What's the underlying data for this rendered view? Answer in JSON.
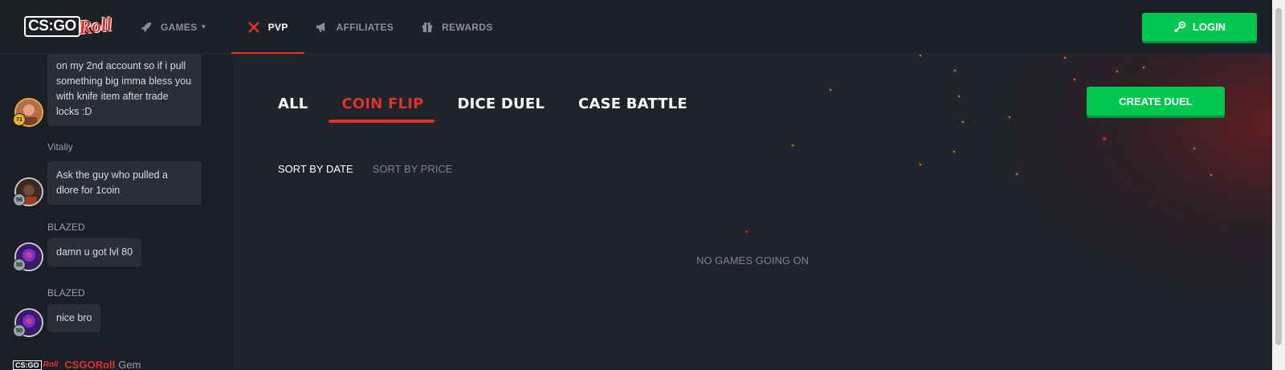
{
  "header": {
    "logo": {
      "text_main": "CS:GO",
      "text_roll": "Roll"
    },
    "nav": [
      {
        "label": "GAMES",
        "icon": "rocket-icon",
        "has_caret": true
      },
      {
        "label": "PVP",
        "icon": "crossed-swords-icon",
        "active": true
      },
      {
        "label": "AFFILIATES",
        "icon": "megaphone-icon"
      },
      {
        "label": "REWARDS",
        "icon": "gift-icon"
      }
    ],
    "login_label": "LOGIN",
    "login_icon": "steam-icon"
  },
  "chat": {
    "messages": [
      {
        "username": "",
        "level": "71",
        "level_color": "gold",
        "text": "on my 2nd account so if i pull something big imma bless you with knife item after trade locks :D"
      },
      {
        "username": "Vitaliy",
        "level": "56",
        "text": "Ask the guy who pulled a dlore for 1coin"
      },
      {
        "username": "BLAZED",
        "level": "50",
        "text": "damn u got lvl 80"
      },
      {
        "username": "BLAZED",
        "level": "50",
        "text": "nice bro"
      }
    ],
    "bottom": {
      "logo_main": "CS:GO",
      "logo_roll": "Roll",
      "name": "CSGORoll",
      "rank": "Gem"
    }
  },
  "main": {
    "tabs": [
      {
        "label": "ALL"
      },
      {
        "label": "COIN FLIP",
        "active": true
      },
      {
        "label": "DICE DUEL"
      },
      {
        "label": "CASE BATTLE"
      }
    ],
    "create_label": "CREATE DUEL",
    "sort": [
      {
        "label": "SORT BY DATE",
        "active": true
      },
      {
        "label": "SORT BY PRICE"
      }
    ],
    "empty_text": "NO GAMES GOING ON"
  },
  "colors": {
    "accent_red": "#e0312b",
    "accent_green": "#00c74d",
    "bg": "#1f242b"
  }
}
